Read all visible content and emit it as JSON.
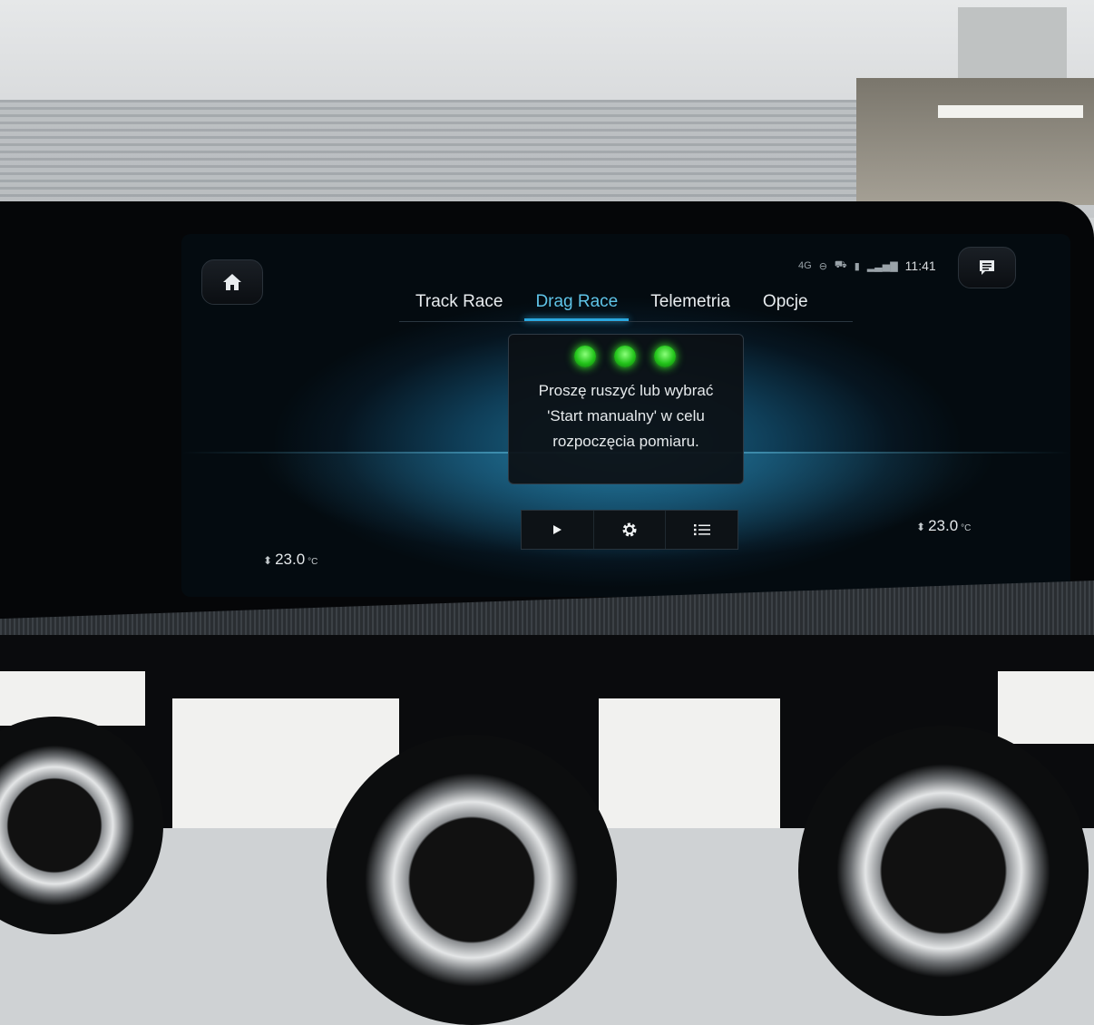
{
  "status_bar": {
    "network": "4G",
    "time": "11:41",
    "icons": [
      "network-4g-icon",
      "hands-free-icon",
      "car-location-icon",
      "battery-icon",
      "signal-strength-icon"
    ]
  },
  "tabs": [
    {
      "label": "Track Race",
      "active": false
    },
    {
      "label": "Drag Race",
      "active": true
    },
    {
      "label": "Telemetria",
      "active": false
    },
    {
      "label": "Opcje",
      "active": false
    }
  ],
  "dialog": {
    "text": "Proszę ruszyć lub wybrać\n'Start manualny' w celu\nrozpoczęcia pomiaru.",
    "lights": [
      "green",
      "green",
      "green"
    ]
  },
  "controls": [
    {
      "name": "play-button",
      "icon": "play-icon"
    },
    {
      "name": "settings-button",
      "icon": "gear-icon"
    },
    {
      "name": "list-button",
      "icon": "list-icon"
    }
  ],
  "climate": {
    "left_temp": "23.0",
    "right_temp": "23.0",
    "unit": "°C"
  },
  "colors": {
    "accent": "#2aa7df",
    "light_green": "#22c31a"
  }
}
